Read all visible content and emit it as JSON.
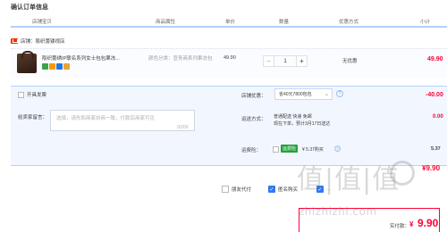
{
  "page_title": "确认订单信息",
  "columns": [
    "店铺宝贝",
    "商品属性",
    "单价",
    "数量",
    "优惠方式",
    "小计"
  ],
  "shop": {
    "label": "店铺：",
    "name": "阪织蕾镂视店"
  },
  "item": {
    "name": "阪织蕾绣IP联名系列女士包包果冻...",
    "attribute": "颜色分类：宣青商系列果冻包",
    "price": "49.90",
    "quantity": "1",
    "discount_method": "无优惠",
    "subtotal": "49.90",
    "badge_colors": [
      "#3aa34a",
      "#f59a00",
      "#2a76d6",
      "#e9a23b"
    ]
  },
  "invoice_label": "开具发票",
  "message": {
    "label": "给卖家留言：",
    "placeholder": "选填，请先和商家协商一致，付款后商家可见",
    "counter": "0/200"
  },
  "shop_discount": {
    "label": "店铺优惠：",
    "selected": "省40元7800包包",
    "amount": "-40.00"
  },
  "shipping": {
    "label": "运送方式：",
    "line1": "普通配送 快递 免邮",
    "line2": "现在下单，预计3月17日送达",
    "fee": "0.00"
  },
  "insurance": {
    "label": "运费险：",
    "tag": "运费险",
    "text": "¥ 5.37购买",
    "fee": "5.37"
  },
  "shop_total": "¥9.90",
  "options": {
    "friend_pay": "朋友代付",
    "anonymous": "匿名购买",
    "extra": "..."
  },
  "payment": {
    "label": "实付款：",
    "currency": "¥",
    "amount": "9.90"
  },
  "watermark": {
    "logo": "值|值|值",
    "url": "zhizhizhi.com"
  },
  "colors": {
    "accent": "#ff0036",
    "border_blue": "#b2d1ff",
    "check_blue": "#2f7aee"
  }
}
